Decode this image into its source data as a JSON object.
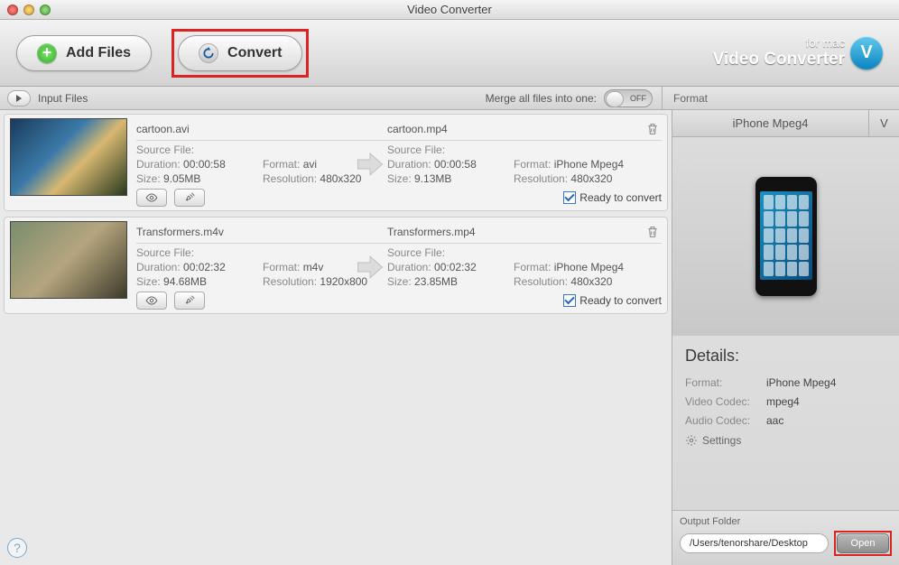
{
  "window": {
    "title": "Video Converter"
  },
  "toolbar": {
    "add_files_label": "Add Files",
    "convert_label": "Convert"
  },
  "brand": {
    "line1": "for mac",
    "line2": "Video Converter",
    "logo_letter": "V"
  },
  "secbar": {
    "input_files_label": "Input Files",
    "merge_label": "Merge all files into one:",
    "toggle_state": "OFF",
    "format_label": "Format"
  },
  "files": [
    {
      "src_name": "cartoon.avi",
      "dst_name": "cartoon.mp4",
      "src": {
        "header": "Source File:",
        "duration_label": "Duration:",
        "duration": "00:00:58",
        "format_label": "Format:",
        "format": "avi",
        "size_label": "Size:",
        "size": "9.05MB",
        "resolution_label": "Resolution:",
        "resolution": "480x320"
      },
      "dst": {
        "header": "Source File:",
        "duration_label": "Duration:",
        "duration": "00:00:58",
        "format_label": "Format:",
        "format": "iPhone Mpeg4",
        "size_label": "Size:",
        "size": "9.13MB",
        "resolution_label": "Resolution:",
        "resolution": "480x320"
      },
      "ready_label": "Ready to convert"
    },
    {
      "src_name": "Transformers.m4v",
      "dst_name": "Transformers.mp4",
      "src": {
        "header": "Source File:",
        "duration_label": "Duration:",
        "duration": "00:02:32",
        "format_label": "Format:",
        "format": "m4v",
        "size_label": "Size:",
        "size": "94.68MB",
        "resolution_label": "Resolution:",
        "resolution": "1920x800"
      },
      "dst": {
        "header": "Source File:",
        "duration_label": "Duration:",
        "duration": "00:02:32",
        "format_label": "Format:",
        "format": "iPhone Mpeg4",
        "size_label": "Size:",
        "size": "23.85MB",
        "resolution_label": "Resolution:",
        "resolution": "480x320"
      },
      "ready_label": "Ready to convert"
    }
  ],
  "format_panel": {
    "selected_name": "iPhone Mpeg4",
    "v_tab": "V",
    "details_heading": "Details:",
    "rows": {
      "format_k": "Format:",
      "format_v": "iPhone Mpeg4",
      "vcodec_k": "Video Codec:",
      "vcodec_v": "mpeg4",
      "acodec_k": "Audio Codec:",
      "acodec_v": "aac"
    },
    "settings_label": "Settings"
  },
  "output": {
    "section_label": "Output Folder",
    "path": "/Users/tenorshare/Desktop",
    "open_label": "Open"
  },
  "help_glyph": "?"
}
